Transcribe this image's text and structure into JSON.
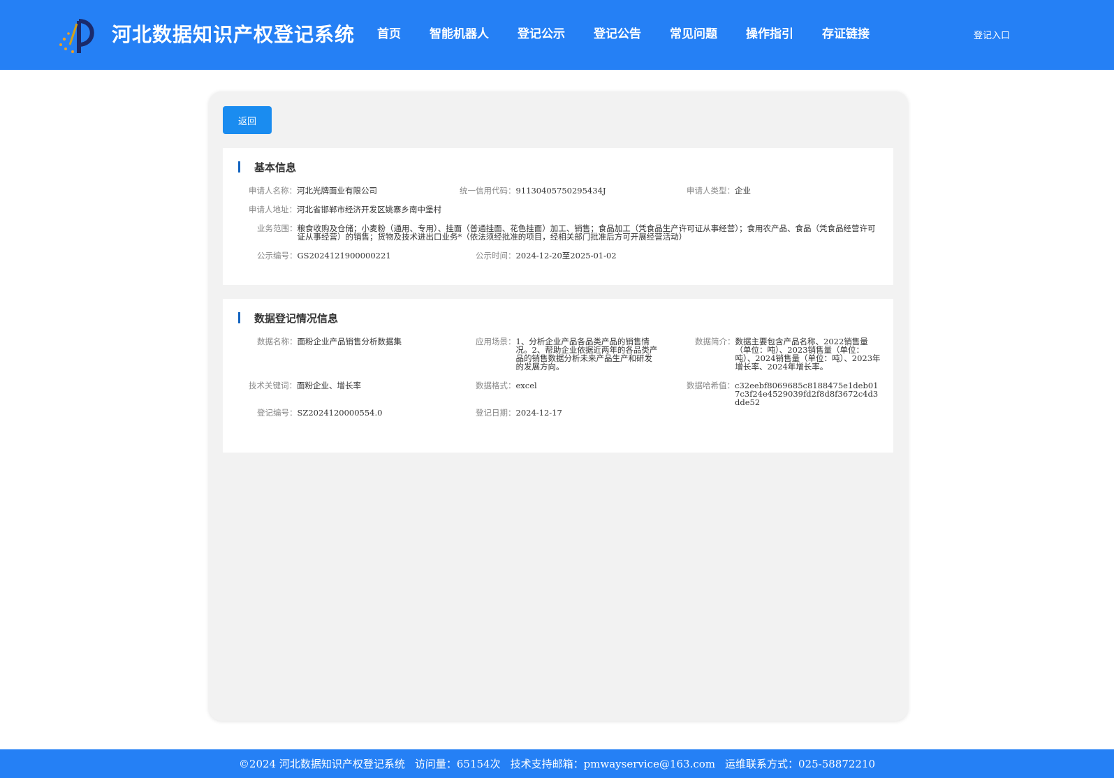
{
  "header": {
    "site_title": "河北数据知识产权登记系统",
    "nav": [
      "首页",
      "智能机器人",
      "登记公示",
      "登记公告",
      "常见问题",
      "操作指引",
      "存证链接"
    ],
    "login": "登记入口"
  },
  "back_button": "返回",
  "basic_info": {
    "title": "基本信息",
    "applicant_name": {
      "label": "申请人名称：",
      "value": "河北光牌面业有限公司"
    },
    "credit_code": {
      "label": "统一信用代码：",
      "value": "91130405750295434J"
    },
    "applicant_type": {
      "label": "申请人类型：",
      "value": "企业"
    },
    "address": {
      "label": "申请人地址：",
      "value": "河北省邯郸市经济开发区姚寨乡南中堡村"
    },
    "business_scope": {
      "label": "业务范围：",
      "value": "粮食收购及仓储；小麦粉（通用、专用）、挂面（普通挂面、花色挂面）加工、销售；食品加工（凭食品生产许可证从事经营）；食用农产品、食品（凭食品经营许可证从事经营）的销售；货物及技术进出口业务*（依法须经批准的项目，经相关部门批准后方可开展经营活动）"
    },
    "publicity_no": {
      "label": "公示编号：",
      "value": "GS2024121900000221"
    },
    "publicity_time": {
      "label": "公示时间：",
      "value": "2024-12-20至2025-01-02"
    }
  },
  "data_info": {
    "title": "数据登记情况信息",
    "data_name": {
      "label": "数据名称：",
      "value": "面粉企业产品销售分析数据集"
    },
    "scenario": {
      "label": "应用场景：",
      "value": "1、分析企业产品各品类产品的销售情况。2、帮助企业依据近两年的各品类产品的销售数据分析未来产品生产和研发的发展方向。"
    },
    "summary": {
      "label": "数据简介：",
      "value": "数据主要包含产品名称、2022销售量（单位：吨）、2023销售量（单位：吨）、2024销售量（单位：吨）、2023年增长率、2024年增长率。"
    },
    "keywords": {
      "label": "技术关键词：",
      "value": "面粉企业、增长率"
    },
    "format": {
      "label": "数据格式：",
      "value": "excel"
    },
    "hash": {
      "label": "数据哈希值：",
      "value": "c32eebf8069685c8188475e1deb017c3f24e4529039fd2f8d8f3672c4d3dde52"
    },
    "reg_no": {
      "label": "登记编号：",
      "value": "SZ2024120000554.0"
    },
    "reg_date": {
      "label": "登记日期：",
      "value": "2024-12-17"
    }
  },
  "footer": {
    "copyright": "©2024 河北数据知识产权登记系统",
    "visits": "访问量：65154次",
    "email": "技术支持邮箱：pmwayservice@163.com",
    "contact": "运维联系方式：025-58872210"
  }
}
